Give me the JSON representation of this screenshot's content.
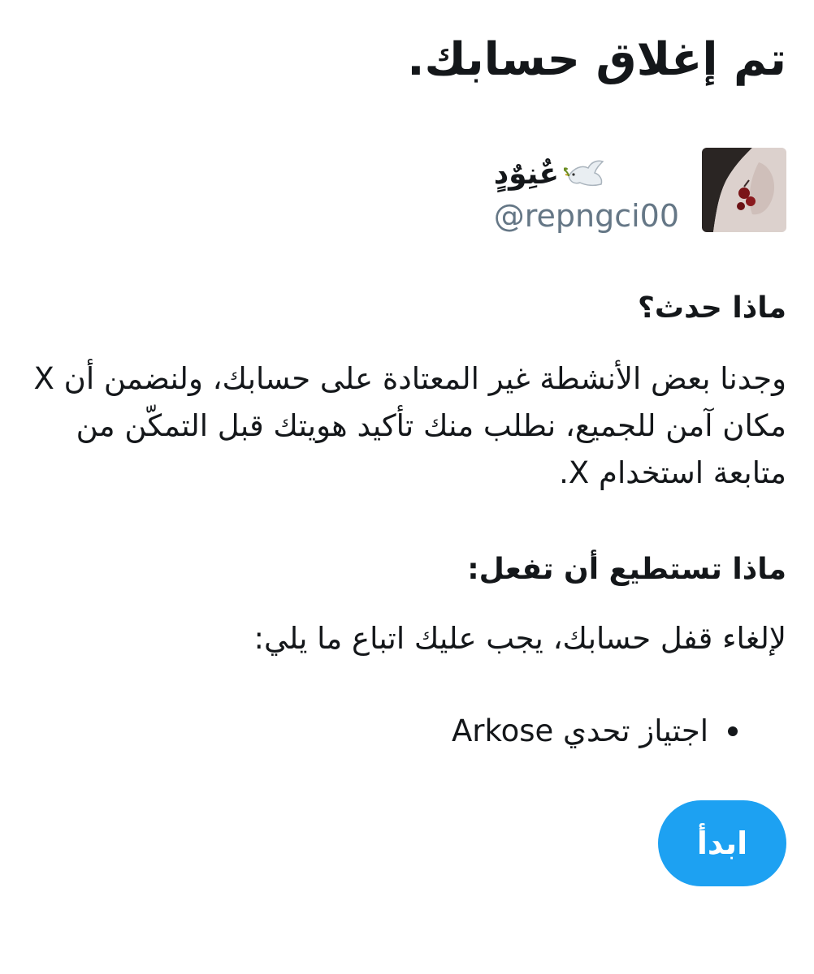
{
  "title": "تم إغلاق حسابك.",
  "user": {
    "display_name": "عٌنِوٌدٍ",
    "handle": "@repngci00",
    "avatar_icon": "profile-photo",
    "emoji_icon": "dove-of-peace-icon"
  },
  "sections": {
    "what_happened": {
      "heading": "ماذا حدث؟",
      "body": "وجدنا بعض الأنشطة غير المعتادة على حسابك، ولنضمن أن X مكان آمن للجميع، نطلب منك تأكيد هويتك قبل التمكّن من متابعة استخدام X."
    },
    "what_you_can_do": {
      "heading": "ماذا تستطيع أن تفعل:",
      "body": "لإلغاء قفل حسابك، يجب عليك اتباع ما يلي:",
      "steps": [
        "اجتياز تحدي Arkose"
      ]
    }
  },
  "actions": {
    "start_label": "ابدأ"
  },
  "colors": {
    "accent": "#1da1f2",
    "text": "#14171a",
    "secondary_text": "#657786"
  }
}
